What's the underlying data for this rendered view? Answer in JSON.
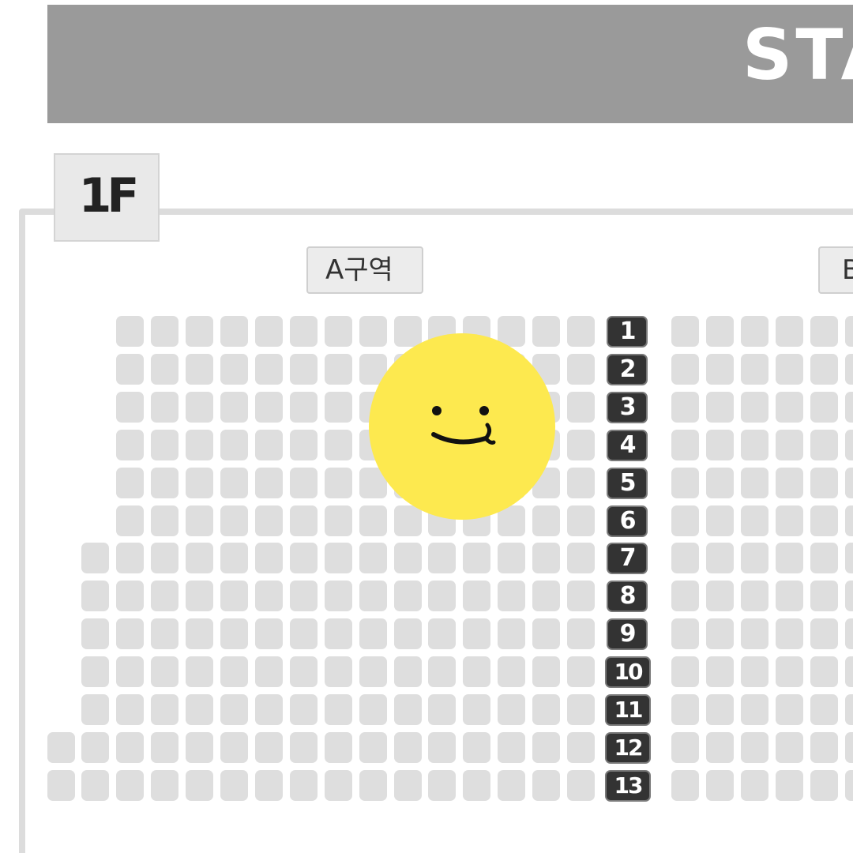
{
  "stage": {
    "label": "STA"
  },
  "floor": {
    "label": "1F"
  },
  "sections": [
    {
      "label": "A구역"
    },
    {
      "label": "B"
    }
  ],
  "rows": [
    "1",
    "2",
    "3",
    "4",
    "5",
    "6",
    "7",
    "8",
    "9",
    "10",
    "11",
    "12",
    "13"
  ],
  "colors": {
    "stage_bg": "#9a9a9a",
    "seat_available": "#dedede",
    "row_badge": "#333333",
    "sticker": "#fde94f"
  },
  "icons": {
    "sticker": "smiley-face-icon"
  }
}
